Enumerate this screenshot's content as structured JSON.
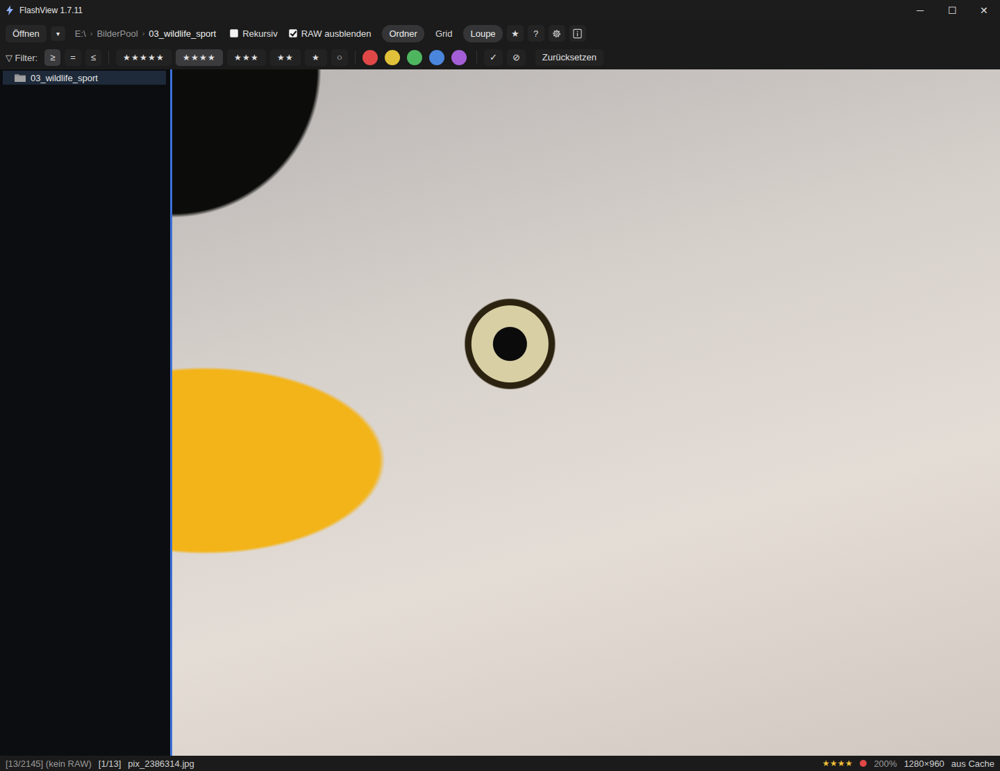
{
  "window": {
    "title": "FlashView 1.7.11",
    "controls": [
      "─",
      "☐",
      "✕"
    ]
  },
  "toolbar": {
    "open": {
      "label": "Öffnen",
      "dropdown": "▾"
    },
    "breadcrumb": {
      "separator": "›",
      "items": [
        "E:\\",
        "BilderPool",
        "03_wildlife_sport"
      ]
    },
    "checkboxes": [
      {
        "label": "Rekursiv",
        "checked": false
      },
      {
        "label": "RAW ausblenden",
        "checked": true
      }
    ],
    "views": [
      {
        "label": "Ordner",
        "selected": true
      },
      {
        "label": "Grid",
        "selected": false
      },
      {
        "label": "Loupe",
        "selected": true
      }
    ],
    "tools": [
      {
        "kind": "text",
        "label": "★"
      },
      {
        "kind": "text",
        "label": "?"
      },
      {
        "kind": "gear",
        "label": ""
      },
      {
        "kind": "info",
        "label": ""
      }
    ]
  },
  "filter": {
    "icon": "▽",
    "label": "Filter:",
    "operators": [
      {
        "label": "≥",
        "selected": true
      },
      {
        "label": "=",
        "selected": false
      },
      {
        "label": "≤",
        "selected": false
      }
    ],
    "star_glyph": "★",
    "ratings": [
      {
        "stars": 5,
        "selected": false
      },
      {
        "stars": 4,
        "selected": true
      },
      {
        "stars": 3,
        "selected": false
      },
      {
        "stars": 2,
        "selected": false
      },
      {
        "stars": 1,
        "selected": false
      }
    ],
    "unrated": {
      "label": "○",
      "selected": false
    },
    "colors": [
      {
        "color": "#e04848",
        "selected": false
      },
      {
        "color": "#e2c13a",
        "selected": false
      },
      {
        "color": "#4fb660",
        "selected": false
      },
      {
        "color": "#4a86dc",
        "selected": false
      },
      {
        "color": "#a45fd6",
        "selected": false
      }
    ],
    "marks": [
      {
        "label": "✓"
      },
      {
        "label": "⊘"
      }
    ],
    "reset": "Zurücksetzen"
  },
  "sidebar": {
    "items": [
      {
        "label": "03_wildlife_sport",
        "selected": true
      }
    ]
  },
  "status_bar": {
    "position": "[13/2145] (kein RAW)",
    "index": "[1/13]",
    "file": "pix_2386314.jpg",
    "rating": {
      "glyph": "★",
      "stars": 4
    },
    "label_color": "#e04848",
    "zoom": "200%",
    "dimensions": "1280×960",
    "source": "aus Cache"
  }
}
